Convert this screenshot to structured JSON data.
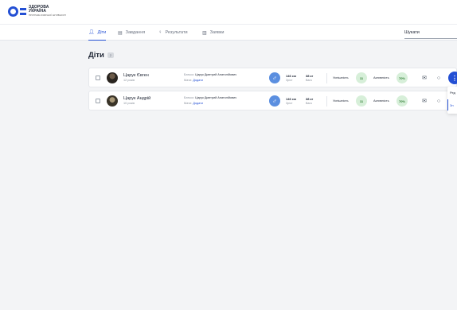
{
  "brand": {
    "line1": "ЗДОРОВА",
    "line2": "УКРАЇНА",
    "tagline": "ПРОГРАМА ФІЗИЧНОЇ АКТИВНОСТІ"
  },
  "nav": {
    "tabs": [
      {
        "label": "Діти",
        "icon": "user-icon",
        "active": true
      },
      {
        "label": "Завдання",
        "icon": "clipboard-icon",
        "active": false
      },
      {
        "label": "Результати",
        "icon": "trophy-icon",
        "active": false
      },
      {
        "label": "Заявки",
        "icon": "document-icon",
        "active": false
      }
    ],
    "search_label": "Шукати"
  },
  "page": {
    "title": "Діти",
    "count": "2"
  },
  "rows": [
    {
      "name": "Царук Євген",
      "age": "12 років",
      "father_label": "Батько:",
      "father": "Царук Дмитрий Анатолійович",
      "mother_label": "Мати:",
      "mother_link": "Додати",
      "height_value": "146 см",
      "height_label": "Зріст",
      "weight_value": "38 кг",
      "weight_label": "Вага",
      "success_label": "Успішність",
      "success_value": "11",
      "activity_label": "Активність",
      "activity_value": "70%"
    },
    {
      "name": "Царук Андрій",
      "age": "10 років",
      "father_label": "Батько:",
      "father": "Царук Дмитрий Анатолійович",
      "mother_label": "Мати:",
      "mother_link": "Додати",
      "height_value": "146 см",
      "height_label": "Зріст",
      "weight_value": "38 кг",
      "weight_label": "Вага",
      "success_label": "Успішність",
      "success_value": "11",
      "activity_label": "Активність",
      "activity_value": "70%"
    }
  ],
  "dropdown": {
    "items": [
      "Ред",
      "Зн"
    ]
  },
  "colors": {
    "accent": "#2450d4",
    "badge_bg": "#d7efd9",
    "badge_text": "#2e7d32",
    "gender_bg": "#5b8fe0"
  }
}
